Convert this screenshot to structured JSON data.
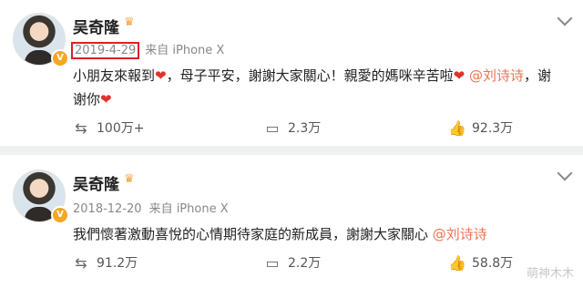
{
  "posts": [
    {
      "username": "吴奇隆",
      "date": "2019-4-29",
      "source": "来自 iPhone X",
      "text_parts": {
        "a": "小朋友來報到",
        "b": "，母子平安，謝謝大家關心！親愛的媽咪辛苦啦",
        "mention": "@刘诗诗",
        "c": "，谢",
        "d": "谢你"
      },
      "actions": {
        "repost": "100万+",
        "comment": "2.3万",
        "like": "92.3万"
      }
    },
    {
      "username": "吴奇隆",
      "date": "2018-12-20",
      "source": "来自 iPhone X",
      "text_parts": {
        "a": "我們懷著激動喜悅的心情期待家庭的新成員，謝謝大家關心",
        "mention": "@刘诗诗"
      },
      "actions": {
        "repost": "91.2万",
        "comment": "2.2万",
        "like": "58.8万"
      }
    }
  ],
  "watermark": "萌神木木",
  "icons": {
    "repost": "repost-icon",
    "comment": "comment-icon",
    "like": "like-icon",
    "heart": "heart-icon",
    "crown": "crown-icon",
    "chevron": "chevron-down-icon"
  },
  "colors": {
    "mention": "#eb7350",
    "heart": "#e0322b",
    "highlight_box": "#e02020",
    "verified": "#f5a623"
  }
}
